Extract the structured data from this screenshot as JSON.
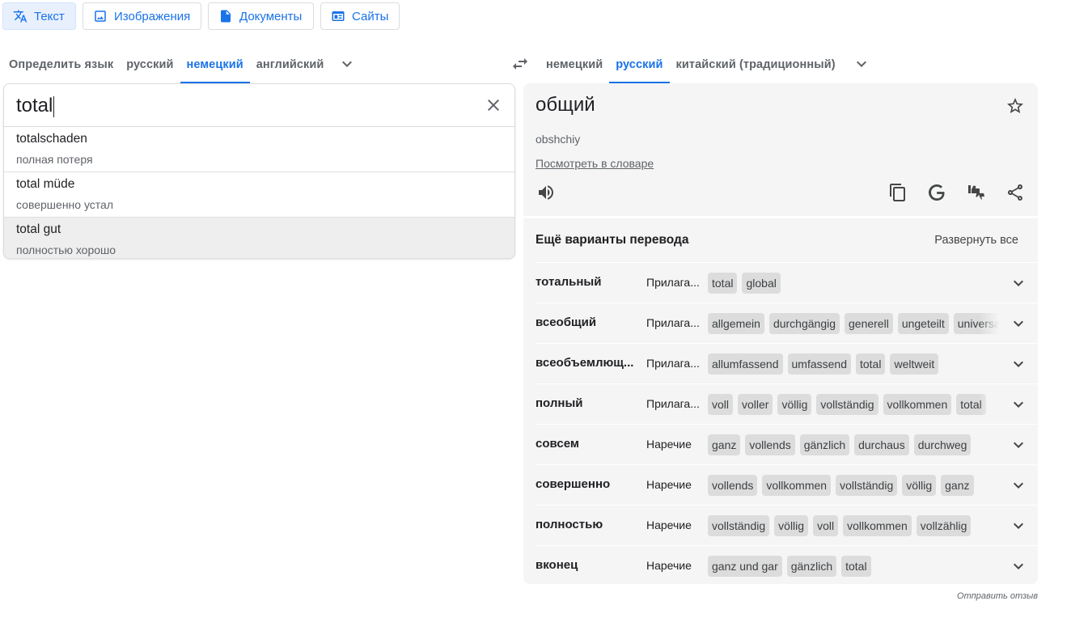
{
  "modes": [
    {
      "label": "Текст",
      "icon": "translate-icon",
      "active": true
    },
    {
      "label": "Изображения",
      "icon": "image-icon"
    },
    {
      "label": "Документы",
      "icon": "document-icon"
    },
    {
      "label": "Сайты",
      "icon": "website-icon"
    }
  ],
  "source_langs": [
    "Определить язык",
    "русский",
    "немецкий",
    "английский"
  ],
  "source_active": "немецкий",
  "target_langs": [
    "немецкий",
    "русский",
    "китайский (традиционный)"
  ],
  "target_active": "русский",
  "source": {
    "text": "total",
    "suggestions": [
      {
        "word": "totalschaden",
        "translation": "полная потеря"
      },
      {
        "word": "total müde",
        "translation": "совершенно устал"
      },
      {
        "word": "total gut",
        "translation": "полностью хорошо"
      }
    ]
  },
  "target": {
    "word": "общий",
    "transliteration": "obshchiy",
    "dictionary_link": "Посмотреть в словаре"
  },
  "more": {
    "heading": "Ещё варианты перевода",
    "expand_all": "Развернуть все",
    "rows": [
      {
        "word": "тотальный",
        "pos": "Прилага...",
        "chips": [
          "total",
          "global"
        ]
      },
      {
        "word": "всеобщий",
        "pos": "Прилага...",
        "chips": [
          "allgemein",
          "durchgängig",
          "generell",
          "ungeteilt",
          "universal"
        ]
      },
      {
        "word": "всеобъемлющ...",
        "pos": "Прилага...",
        "chips": [
          "allumfassend",
          "umfassend",
          "total",
          "weltweit"
        ]
      },
      {
        "word": "полный",
        "pos": "Прилага...",
        "chips": [
          "voll",
          "voller",
          "völlig",
          "vollständig",
          "vollkommen",
          "total"
        ]
      },
      {
        "word": "совсем",
        "pos": "Наречие",
        "chips": [
          "ganz",
          "vollends",
          "gänzlich",
          "durchaus",
          "durchweg"
        ]
      },
      {
        "word": "совершенно",
        "pos": "Наречие",
        "chips": [
          "vollends",
          "vollkommen",
          "vollständig",
          "völlig",
          "ganz"
        ]
      },
      {
        "word": "полностью",
        "pos": "Наречие",
        "chips": [
          "vollständig",
          "völlig",
          "voll",
          "vollkommen",
          "vollzählig"
        ]
      },
      {
        "word": "вконец",
        "pos": "Наречие",
        "chips": [
          "ganz und gar",
          "gänzlich",
          "total"
        ]
      }
    ]
  },
  "feedback": "Отправить отзыв"
}
